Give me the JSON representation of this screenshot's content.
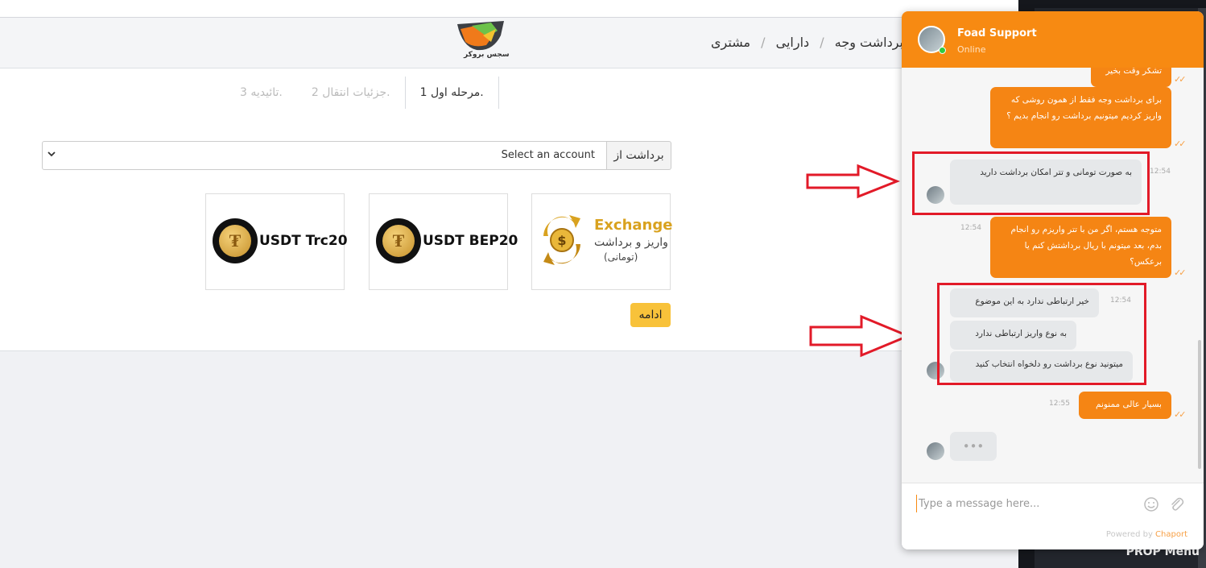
{
  "logo": {
    "text": "سجس بروکر"
  },
  "breadcrumb": {
    "items": [
      "برداشت وجه",
      "دارایی",
      "مشتری"
    ]
  },
  "steps": [
    {
      "label": "تائیدیه 3."
    },
    {
      "label": "جزئیات انتقال 2."
    },
    {
      "label": "مرحله اول 1."
    }
  ],
  "account": {
    "label": "برداشت از",
    "selected": "Select an account"
  },
  "methods": [
    {
      "label": "USDT Trc20",
      "icon": "tether-coin-icon"
    },
    {
      "label": "USDT BEP20",
      "icon": "tether-coin-icon"
    },
    {
      "title": "Exchange",
      "subtitle": "واریز و برداشت",
      "subtitle2": "(تومانی)",
      "icon": "exchange-dollar-icon"
    }
  ],
  "continue_label": "ادامه",
  "chat": {
    "agent_name": "Foad Support",
    "agent_status": "Online",
    "messages": [
      {
        "dir": "out",
        "text": "تشکر وقت بخیر"
      },
      {
        "dir": "out",
        "text": "برای برداشت وجه فقط از همون روشی که واریز کردیم میتونیم برداشت رو انجام بدیم ؟"
      },
      {
        "dir": "in",
        "time": "12:54",
        "text": "به صورت تومانی و تتر امکان برداشت دارید"
      },
      {
        "dir": "out",
        "time": "12:54",
        "text": "متوجه هستم، اگر من با تتر واریزم رو انجام بدم، بعد میتونم با ریال برداشتش کنم یا برعکس؟"
      },
      {
        "dir": "in",
        "time": "12:54",
        "text": "خیر ارتباطی ندارد به این موضوع"
      },
      {
        "dir": "in",
        "text": "به نوع واریز ارتباطی ندارد"
      },
      {
        "dir": "in",
        "text": "میتونید نوع برداشت رو دلخواه انتخاب کنید"
      },
      {
        "dir": "out",
        "time": "12:55",
        "text": "بسیار عالی ممنونم"
      }
    ],
    "typing": "•••",
    "input_placeholder": "Type a message here...",
    "powered_prefix": "Powered by ",
    "powered_brand": "Chaport"
  },
  "sidebar": {
    "menu_label": "PROP Menu"
  },
  "colors": {
    "accent": "#f78a12",
    "button": "#f8c23a",
    "highlight": "#e21a28"
  }
}
